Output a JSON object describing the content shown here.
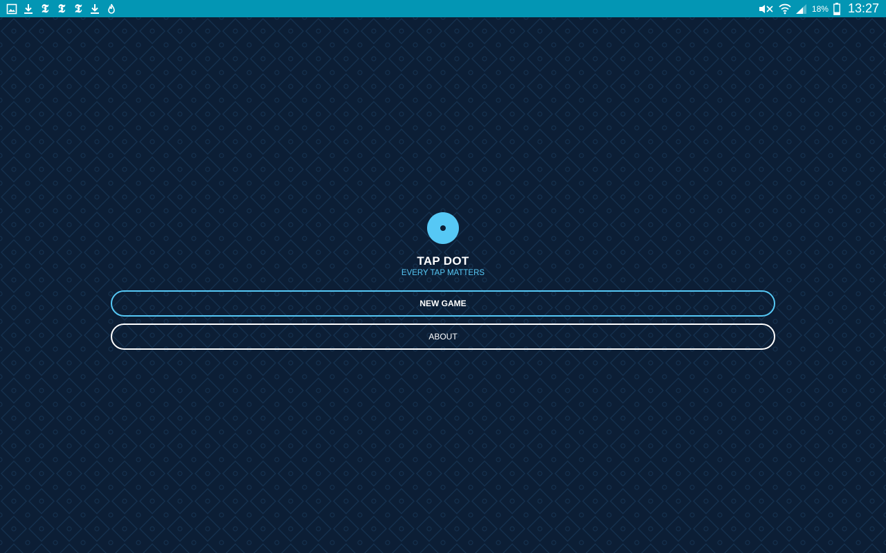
{
  "status_bar": {
    "notification_icons": [
      "gallery-icon",
      "download-icon",
      "nyt-icon",
      "nyt-icon",
      "nyt-icon",
      "download-icon",
      "flame-icon"
    ],
    "nyt_glyph": "𝕿",
    "battery_percent": "18%",
    "time": "13:27"
  },
  "app": {
    "title": "TAP DOT",
    "subtitle": "EVERY TAP MATTERS",
    "accent_color": "#56c8f5",
    "background_color": "#0c1e35"
  },
  "menu": {
    "new_game_label": "NEW GAME",
    "about_label": "ABOUT"
  }
}
